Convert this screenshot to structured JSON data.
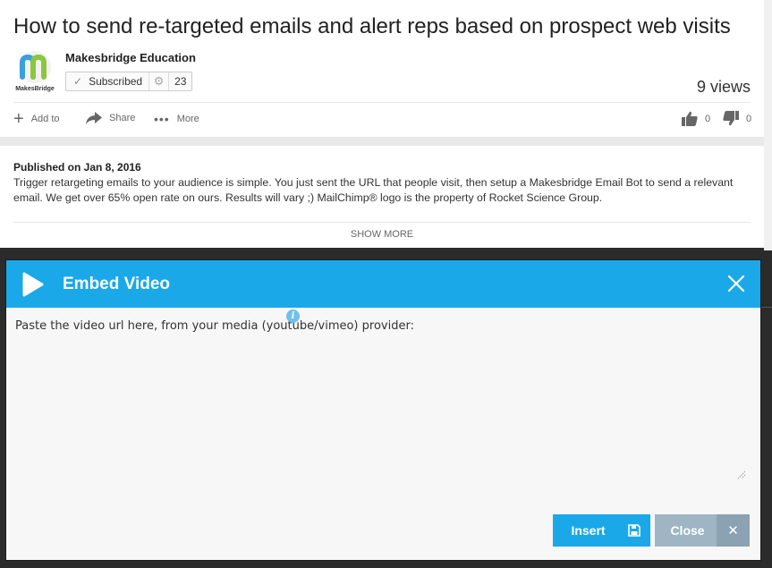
{
  "video": {
    "title": "How to send re-targeted emails and alert reps based on prospect web visits",
    "channel_name": "Makesbridge Education",
    "channel_logo_text": "MakesBridge",
    "subscribe_label": "Subscribed",
    "subscriber_count": "23",
    "views": "9 views",
    "actions": {
      "add_to": "Add to",
      "share": "Share",
      "more": "More"
    },
    "likes": "0",
    "dislikes": "0"
  },
  "description": {
    "published": "Published on Jan 8, 2016",
    "text": "Trigger retargeting emails to your audience is simple. You just sent the URL that people visit, then setup a Makesbridge Email Bot to send a relevant email. We get over 65% open rate on ours. Results will vary ;) MailChimp® logo is the property of Rocket Science Group.",
    "show_more": "SHOW MORE"
  },
  "modal": {
    "title": "Embed Video",
    "prompt": "Paste the video url here, from your media (youtube/vimeo) provider:",
    "url_value": "",
    "insert_label": "Insert",
    "close_label": "Close",
    "accent_color": "#1aa8e8",
    "close_color": "#9fb5c3"
  }
}
